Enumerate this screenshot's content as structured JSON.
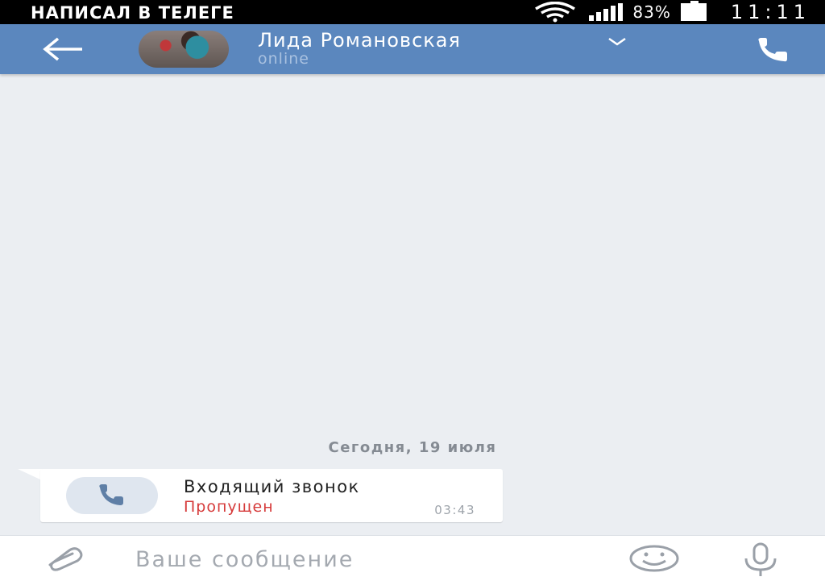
{
  "overlay": {
    "caption": "НАПИСАЛ В ТЕЛЕГЕ"
  },
  "status_bar": {
    "battery_percent": "83%",
    "time": "11:11",
    "icons": [
      "wifi-icon",
      "signal-icon",
      "battery-icon"
    ]
  },
  "header": {
    "back_icon": "arrow-left-icon",
    "contact_name": "Лида Романовская",
    "contact_status": "online",
    "chevron_icon": "chevron-down-icon",
    "call_icon": "phone-icon",
    "bar_color": "#5b87be"
  },
  "chat": {
    "date_separator": "Сегодня, 19 июля",
    "messages": [
      {
        "type": "call",
        "icon": "phone-icon",
        "title": "Входящий звонок",
        "status": "Пропущен",
        "status_color": "#d63b3b",
        "time": "03:43"
      }
    ]
  },
  "input_bar": {
    "placeholder": "Ваше сообщение",
    "value": "",
    "icons": [
      "paperclip-icon",
      "emoji-icon",
      "microphone-icon"
    ]
  }
}
